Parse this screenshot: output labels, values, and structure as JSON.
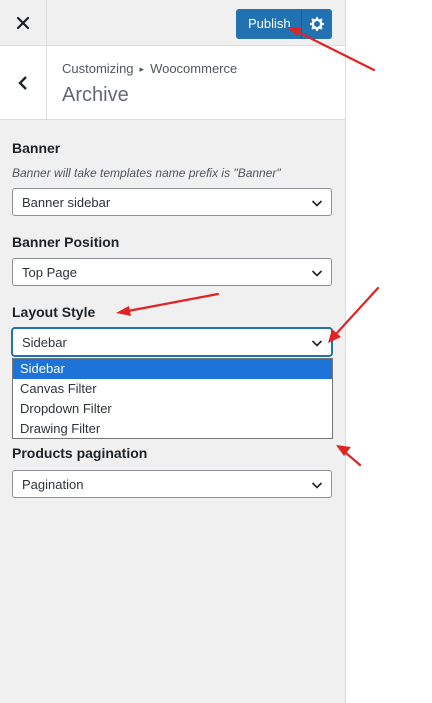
{
  "header": {
    "close_glyph": "✕",
    "publish_label": "Publish"
  },
  "section": {
    "breadcrumb_parent": "Customizing",
    "breadcrumb_separator": "▸",
    "breadcrumb_child": "Woocommerce",
    "title": "Archive"
  },
  "controls": {
    "banner": {
      "title": "Banner",
      "description": "Banner will take templates name prefix is \"Banner\"",
      "value": "Banner sidebar"
    },
    "banner_position": {
      "title": "Banner Position",
      "value": "Top Page"
    },
    "layout_style": {
      "title": "Layout Style",
      "value": "Sidebar",
      "options": [
        "Sidebar",
        "Canvas Filter",
        "Dropdown Filter",
        "Drawing Filter"
      ]
    },
    "products_pagination": {
      "title": "Products pagination",
      "value": "Pagination"
    }
  },
  "colors": {
    "accent": "#2271b1",
    "selected_option": "#1e73d8",
    "annotation_arrow": "#e02424",
    "panel_bg": "#f0f0f1"
  },
  "icons": [
    "close-icon",
    "gear-icon",
    "back-chevron-icon",
    "chevron-down-icon"
  ]
}
